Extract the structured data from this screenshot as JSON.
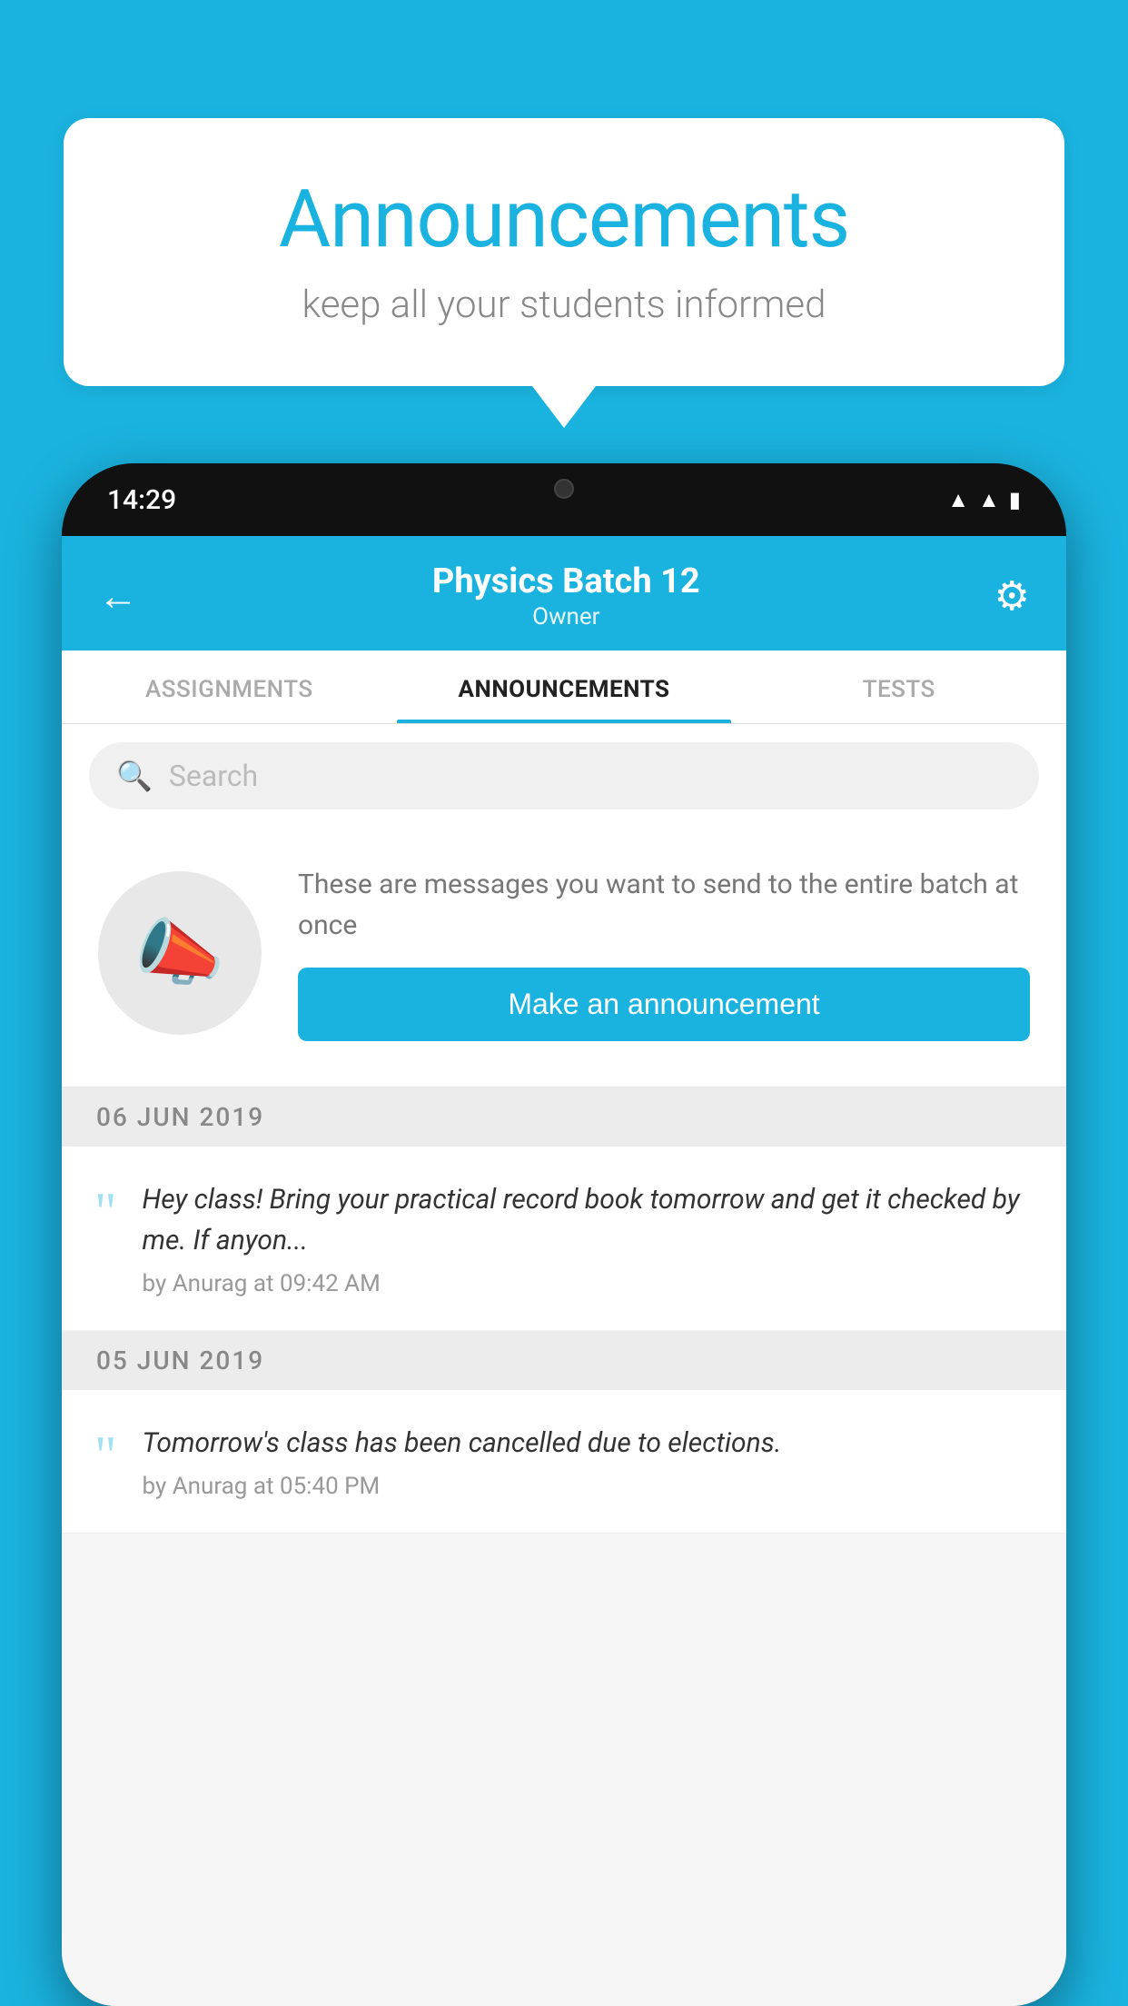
{
  "background_color": "#1ab3e0",
  "speech_bubble": {
    "title": "Announcements",
    "subtitle": "keep all your students informed"
  },
  "phone": {
    "status_bar": {
      "time": "14:29"
    },
    "header": {
      "title": "Physics Batch 12",
      "subtitle": "Owner",
      "back_label": "←",
      "gear_label": "⚙"
    },
    "tabs": [
      {
        "label": "ASSIGNMENTS",
        "active": false
      },
      {
        "label": "ANNOUNCEMENTS",
        "active": true
      },
      {
        "label": "TESTS",
        "active": false
      },
      {
        "label": "...",
        "active": false
      }
    ],
    "search": {
      "placeholder": "Search"
    },
    "announcement_prompt": {
      "description": "These are messages you want to send to the entire batch at once",
      "button_label": "Make an announcement"
    },
    "announcement_groups": [
      {
        "date": "06  JUN  2019",
        "items": [
          {
            "message": "Hey class! Bring your practical record book tomorrow and get it checked by me. If anyon...",
            "meta": "by Anurag at 09:42 AM"
          }
        ]
      },
      {
        "date": "05  JUN  2019",
        "items": [
          {
            "message": "Tomorrow's class has been cancelled due to elections.",
            "meta": "by Anurag at 05:40 PM"
          }
        ]
      }
    ]
  }
}
